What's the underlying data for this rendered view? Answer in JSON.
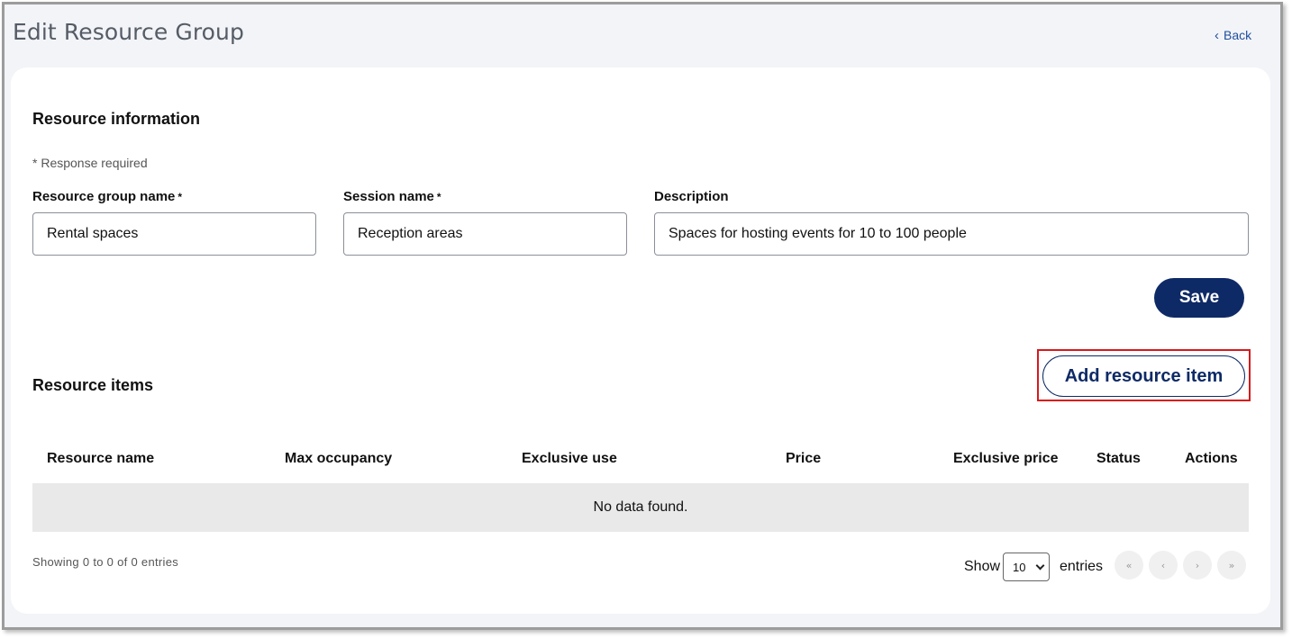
{
  "header": {
    "title": "Edit Resource Group",
    "back_label": "Back"
  },
  "resource_info": {
    "title": "Resource information",
    "required_note": "* Response required",
    "fields": {
      "group_name": {
        "label": "Resource group name",
        "required_mark": "*",
        "value": "Rental spaces"
      },
      "session_name": {
        "label": "Session name",
        "required_mark": "*",
        "value": "Reception areas"
      },
      "description": {
        "label": "Description",
        "value": "Spaces for hosting events for 10 to 100 people"
      }
    },
    "save_label": "Save"
  },
  "resource_items": {
    "title": "Resource items",
    "add_label": "Add resource item",
    "columns": [
      "Resource name",
      "Max occupancy",
      "Exclusive use",
      "Price",
      "Exclusive price",
      "Status",
      "Actions"
    ],
    "empty_text": "No data found.",
    "showing_text": "Showing 0 to 0 of 0 entries",
    "show_label": "Show",
    "page_size": "10",
    "entries_label": "entries",
    "pagination": [
      "«",
      "‹",
      "›",
      "»"
    ]
  },
  "colors": {
    "primary": "#0e2a66",
    "link": "#1f4f9c",
    "highlight": "#d7191c",
    "background": "#f3f4f8"
  }
}
